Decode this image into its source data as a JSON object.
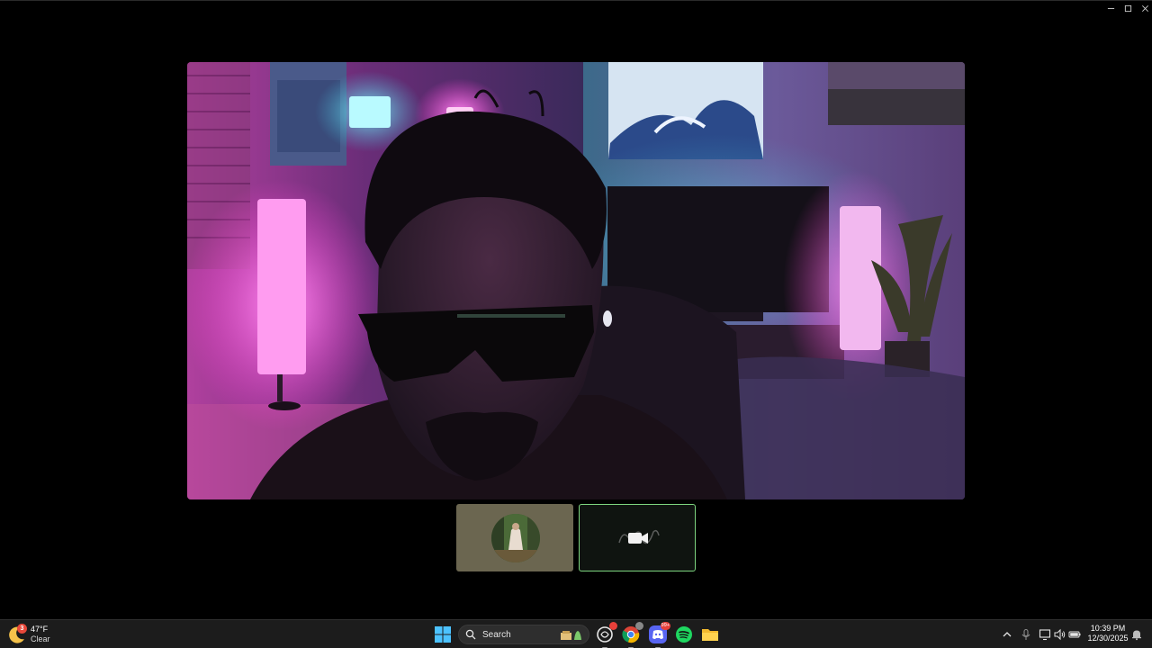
{
  "window": {
    "controls": [
      "minimize",
      "maximize",
      "close"
    ]
  },
  "video_call": {
    "main_stream_icon": "webcam-feed",
    "participants": [
      {
        "type": "avatar",
        "icon": "profile-photo-avatar"
      },
      {
        "type": "camera-off",
        "icon": "video-camera-icon",
        "active": true
      }
    ],
    "accent_color": "#7cd47e"
  },
  "taskbar": {
    "weather": {
      "badge": "3",
      "temperature": "47°F",
      "condition": "Clear"
    },
    "search": {
      "label": "Search"
    },
    "apps": [
      {
        "name": "ai-assistant",
        "badge": ""
      },
      {
        "name": "chrome",
        "badge": ""
      },
      {
        "name": "discord",
        "badge": "99+"
      },
      {
        "name": "spotify",
        "badge": ""
      },
      {
        "name": "file-explorer",
        "badge": ""
      }
    ],
    "tray": {
      "time": "10:39 PM",
      "date": "12/30/2025"
    }
  }
}
